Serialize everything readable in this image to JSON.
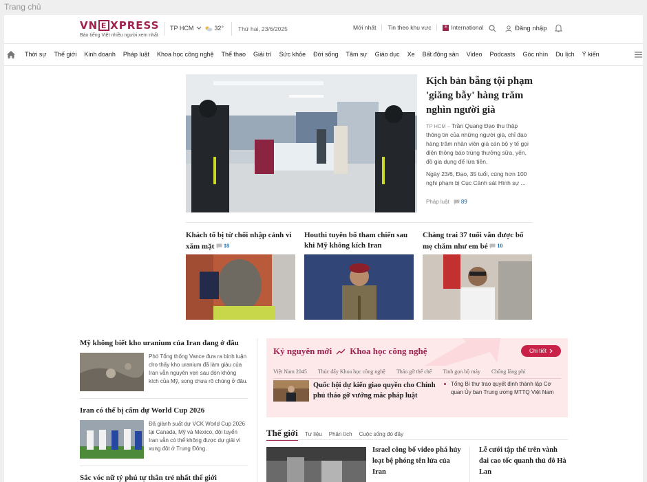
{
  "browser": {
    "tab_title": "Trang chủ"
  },
  "header": {
    "logo_left": "VN",
    "logo_box": "E",
    "logo_right": "XPRESS",
    "tagline": "Báo tiếng Việt nhiều người xem nhất",
    "location": "TP HCM",
    "temperature": "32°",
    "date": "Thứ hai, 23/6/2025",
    "links": [
      "Mới nhất",
      "Tin theo khu vực",
      "International"
    ],
    "login": "Đăng nhập"
  },
  "nav": {
    "items": [
      "Thời sự",
      "Thế giới",
      "Kinh doanh",
      "Pháp luật",
      "Khoa học công nghệ",
      "Thể thao",
      "Giải trí",
      "Sức khỏe",
      "Đời sống",
      "Tâm sự",
      "Giáo dục",
      "Xe",
      "Bất động sản",
      "Video",
      "Podcasts",
      "Góc nhìn",
      "Du lịch",
      "Ý kiến"
    ]
  },
  "hero": {
    "title": "Kịch bản bẵng tội phạm 'giăng bẫy' hàng trăm nghìn người già",
    "location": "TP HCM",
    "desc": "Trần Quang Đạo thu thập thông tin của những người già, chỉ đạo hàng trăm nhân viên giả cán bộ y tế gọi điện thông báo trúng thưởng sữa, yến, đồ gia dụng để lừa tiền.",
    "desc2": "Ngày 23/6, Đạo, 35 tuổi, cùng hơn 100 nghi phạm bị Cục Cảnh sát Hình sự ...",
    "category": "Pháp luật",
    "comments": "89"
  },
  "sub_articles": [
    {
      "title": "Khách tố bị từ chối nhập cảnh vì xăm mặt",
      "comments": "18"
    },
    {
      "title": "Houthi tuyên bố tham chiến sau khi Mỹ không kích Iran",
      "comments": ""
    },
    {
      "title": "Chàng trai 37 tuổi vẫn được bố mẹ chăm như em bé",
      "comments": "10"
    }
  ],
  "left_col": [
    {
      "title": "Mỹ không biết kho uranium của Iran đang ở đâu",
      "desc": "Phó Tổng thống Vance đưa ra bình luận cho thấy kho uranium đã làm giàu của Iran vẫn nguyên vẹn sau đòn không kích của Mỹ, song chưa rõ chúng ở đâu."
    },
    {
      "title": "Iran có thể bị cấm dự World Cup 2026",
      "desc": "Đã giành suất dự VCK World Cup 2026 tại Canada, Mỹ và Mexico, đội tuyển Iran vẫn có thể không được dự giải vì xung đột ở Trung Đông."
    },
    {
      "title": "Sắc vóc nữ tỷ phú tự thân trẻ nhất thế giới",
      "desc": ""
    }
  ],
  "innovation": {
    "heading_left": "Kỷ nguyên mới",
    "heading_right": "Khoa học công nghệ",
    "button": "Chi tiết",
    "tabs": [
      "Việt Nam 2045",
      "Thúc đẩy Khoa học công nghệ",
      "Tháo gỡ thể chế",
      "Tinh gọn bộ máy",
      "Chống lãng phí"
    ],
    "main_title": "Quốc hội dự kiến giao quyền cho Chính phủ tháo gỡ vướng mắc pháp luật",
    "side_item": "Tổng Bí thư trao quyết định thành lập Cơ quan Ủy ban Trung ương MTTQ Việt Nam"
  },
  "the_gioi": {
    "title": "Thế giới",
    "links": [
      "Tư liệu",
      "Phân tích",
      "Cuộc sống đó đây"
    ],
    "article1": "Israel công bố video phá hủy loạt bệ phóng tên lửa của Iran",
    "article2": "Lễ cưới tập thể trên vành đai cao tốc quanh thủ đô Hà Lan"
  },
  "colors": {
    "brand": "#9f224e",
    "accent_red": "#c92249",
    "comment_blue": "#076db6",
    "innovation_bg": "#fde8ea"
  }
}
